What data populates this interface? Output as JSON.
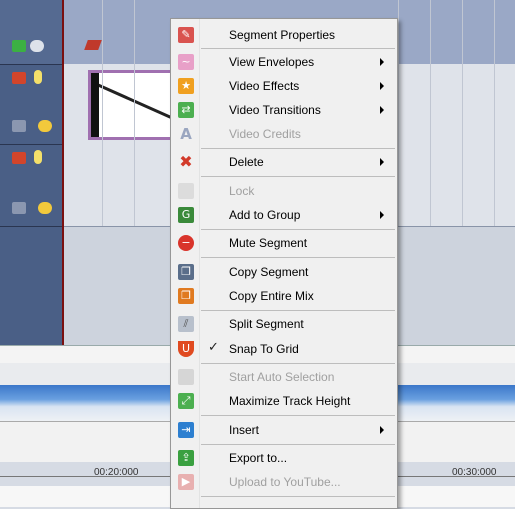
{
  "colors": {
    "header_bg": "#4a5f86",
    "menu_bg": "#f0f0f0",
    "clip_border": "#a070b0",
    "playhead": "#7a1010"
  },
  "ruler": {
    "left_time": "00:20:000",
    "right_time": "00:30:000"
  },
  "context_menu": {
    "items": [
      {
        "label": "Segment Properties",
        "icon": "segment-properties-icon",
        "disabled": false,
        "submenu": false
      },
      {
        "label": "View Envelopes",
        "icon": "envelope-icon",
        "disabled": false,
        "submenu": true
      },
      {
        "label": "Video Effects",
        "icon": "video-effects-icon",
        "disabled": false,
        "submenu": true
      },
      {
        "label": "Video Transitions",
        "icon": "video-transitions-icon",
        "disabled": false,
        "submenu": true
      },
      {
        "label": "Video Credits",
        "icon": "credits-icon",
        "disabled": true,
        "submenu": false
      },
      {
        "label": "Delete",
        "icon": "delete-icon",
        "disabled": false,
        "submenu": true
      },
      {
        "label": "Lock",
        "icon": "lock-icon",
        "disabled": true,
        "submenu": false
      },
      {
        "label": "Add to Group",
        "icon": "group-icon",
        "disabled": false,
        "submenu": true
      },
      {
        "label": "Mute Segment",
        "icon": "mute-icon",
        "disabled": false,
        "submenu": false
      },
      {
        "label": "Copy Segment",
        "icon": "copy-icon",
        "disabled": false,
        "submenu": false
      },
      {
        "label": "Copy Entire Mix",
        "icon": "copy-mix-icon",
        "disabled": false,
        "submenu": false
      },
      {
        "label": "Split Segment",
        "icon": "split-icon",
        "disabled": false,
        "submenu": false
      },
      {
        "label": "Snap To Grid",
        "icon": "magnet-icon",
        "disabled": false,
        "submenu": false,
        "checked": true
      },
      {
        "label": "Start Auto Selection",
        "icon": "auto-selection-icon",
        "disabled": true,
        "submenu": false
      },
      {
        "label": "Maximize Track Height",
        "icon": "maximize-icon",
        "disabled": false,
        "submenu": false
      },
      {
        "label": "Insert",
        "icon": "insert-icon",
        "disabled": false,
        "submenu": true
      },
      {
        "label": "Export to...",
        "icon": "export-icon",
        "disabled": false,
        "submenu": false
      },
      {
        "label": "Upload to YouTube...",
        "icon": "youtube-icon",
        "disabled": true,
        "submenu": false
      }
    ]
  }
}
